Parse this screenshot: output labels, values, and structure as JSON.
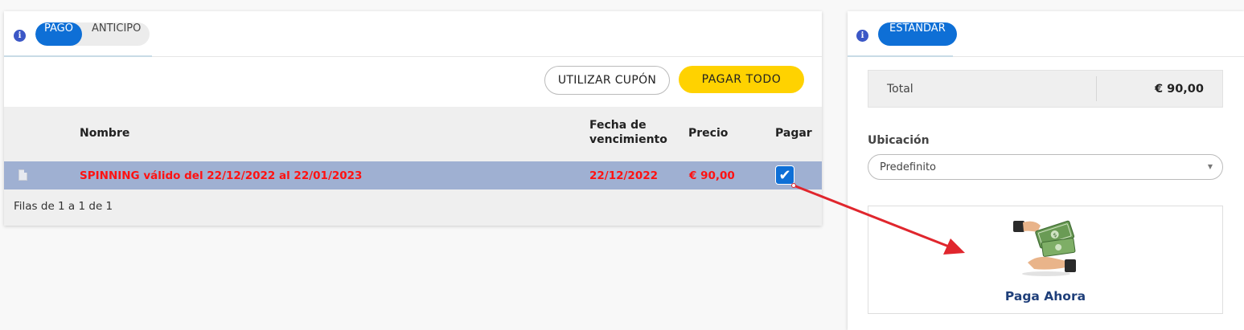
{
  "payment_panel": {
    "tabs": [
      {
        "label": "PAGO",
        "active": true
      },
      {
        "label": "ANTICIPO",
        "active": false
      }
    ],
    "buttons": {
      "coupon_label": "UTILIZAR CUPÓN",
      "pay_all_label": "PAGAR TODO"
    },
    "table": {
      "columns": {
        "nombre": "Nombre",
        "fecha_line1": "Fecha de",
        "fecha_line2": "vencimiento",
        "precio": "Precio",
        "pagar": "Pagar"
      },
      "rows": [
        {
          "nombre": "SPINNING válido del 22/12/2022 al 22/01/2023",
          "fecha": "22/12/2022",
          "precio": "€ 90,00",
          "pagar_checked": true
        }
      ],
      "footer": "Filas de 1 a 1 de 1"
    }
  },
  "summary_panel": {
    "tab_label": "ESTÁNDAR",
    "total_label": "Total",
    "total_value": "€ 90,00",
    "location_label": "Ubicación",
    "location_value": "Predefinito",
    "pay_now_label": "Paga Ahora"
  },
  "colors": {
    "accent_blue": "#0e6fd6",
    "pay_all_yellow": "#ffd200",
    "row_highlight": "#9fb0d2",
    "row_text_red": "#ff1212",
    "annotation_arrow": "#e0262d"
  },
  "icons": [
    "info-icon",
    "document-icon",
    "checkmark-icon",
    "money-hands-icon",
    "dropdown-arrow-icon"
  ]
}
